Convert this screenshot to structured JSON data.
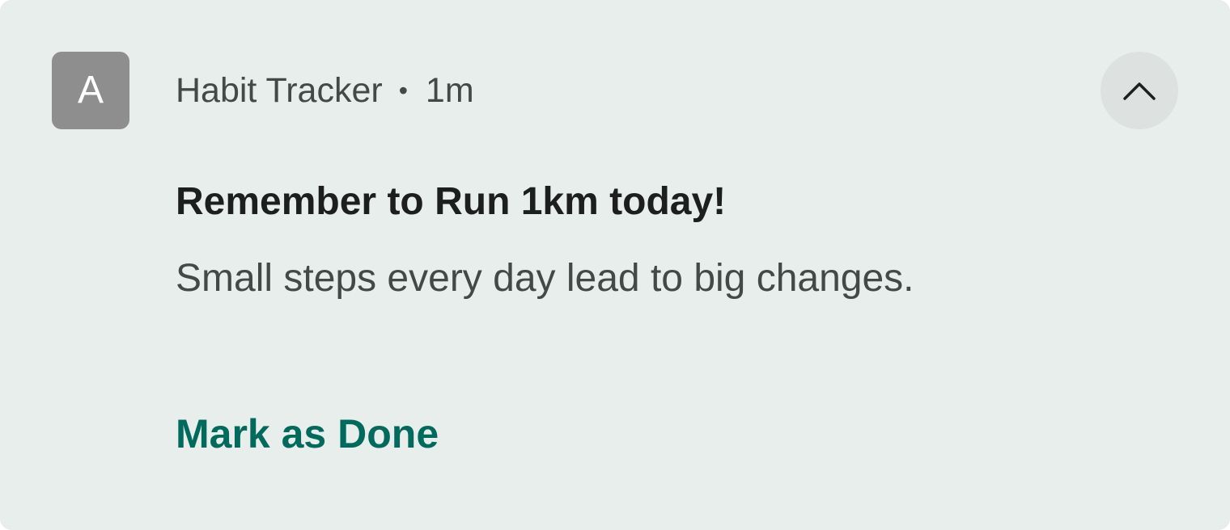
{
  "notification": {
    "app_icon_letter": "A",
    "app_name": "Habit Tracker",
    "separator": "•",
    "time": "1m",
    "title": "Remember to Run 1km today!",
    "body": "Small steps every day lead to big changes.",
    "action_label": "Mark as Done",
    "expand_icon": "chevron-up-icon"
  },
  "colors": {
    "card_background": "#e8eeec",
    "app_icon_background": "#8e8e8e",
    "action_color": "#006b5c",
    "title_color": "#1d1f1e",
    "secondary_text": "#444846",
    "expand_button_background": "#dde2e0"
  }
}
